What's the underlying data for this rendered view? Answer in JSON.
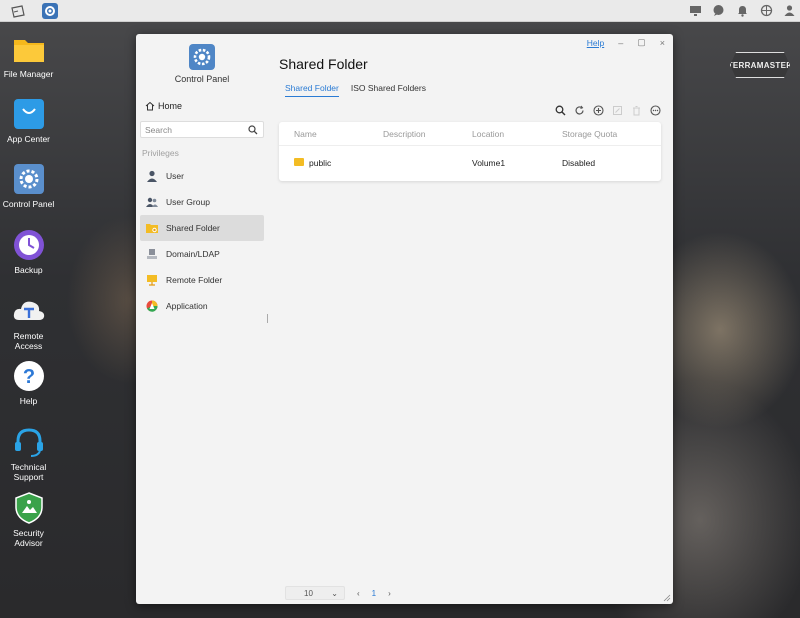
{
  "desktop": {
    "icons": [
      {
        "label": "File Manager",
        "icon": "folder-icon"
      },
      {
        "label": "App Center",
        "icon": "shopping-bag-icon"
      },
      {
        "label": "Control Panel",
        "icon": "gear-icon"
      },
      {
        "label": "Backup",
        "icon": "clock-icon"
      },
      {
        "label": "Remote Access",
        "icon": "cloud-t-icon"
      },
      {
        "label": "Help",
        "icon": "question-icon"
      },
      {
        "label": "Technical Support",
        "icon": "headset-icon"
      },
      {
        "label": "Security Advisor",
        "icon": "shield-icon"
      }
    ],
    "brand": "TERRAMASTER"
  },
  "window": {
    "help": "Help",
    "minimize": "–",
    "maximize": "▢",
    "close": "×",
    "app_title": "Control Panel"
  },
  "sidebar": {
    "home": "Home",
    "search_placeholder": "Search",
    "section": "Privileges",
    "items": [
      {
        "label": "User",
        "icon": "user-icon"
      },
      {
        "label": "User Group",
        "icon": "user-group-icon"
      },
      {
        "label": "Shared Folder",
        "icon": "shared-folder-icon",
        "active": true
      },
      {
        "label": "Domain/LDAP",
        "icon": "domain-icon"
      },
      {
        "label": "Remote Folder",
        "icon": "remote-folder-icon"
      },
      {
        "label": "Application",
        "icon": "application-icon"
      }
    ]
  },
  "main": {
    "title": "Shared Folder",
    "tabs": [
      "Shared Folder",
      "ISO Shared Folders"
    ],
    "columns": [
      "Name",
      "Description",
      "Location",
      "Storage Quota"
    ],
    "rows": [
      {
        "name": "public",
        "description": "",
        "location": "Volume1",
        "quota": "Disabled"
      }
    ],
    "pager": {
      "page_size": "10",
      "page": "1",
      "prev": "‹",
      "next": "›",
      "dropdown": "⌄"
    }
  },
  "colors": {
    "accent": "#2a7bd4",
    "folder": "#f3bc24"
  }
}
